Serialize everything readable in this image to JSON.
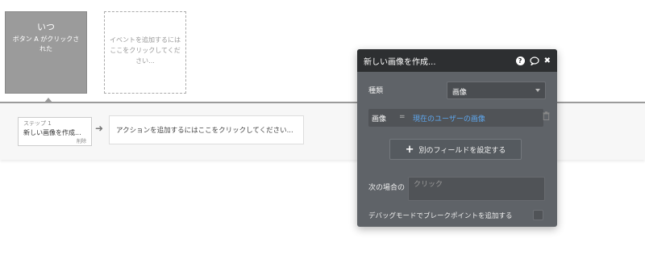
{
  "event": {
    "title": "いつ",
    "description": "ボタン A がクリックされた"
  },
  "add_event": {
    "label": "イベントを追加するにはここをクリックしてください..."
  },
  "step": {
    "label": "ステップ 1",
    "name": "新しい画像を作成...",
    "delete_label": "削除"
  },
  "add_action": {
    "label": "アクションを追加するにはここをクリックしてください..."
  },
  "editor": {
    "title": "新しい画像を作成...",
    "type_label": "種類",
    "type_value": "画像",
    "field_name": "画像",
    "field_eq": "=",
    "field_value": "現在のユーザーの画像",
    "add_field_label": "別のフィールドを設定する",
    "condition_label": "次の場合の",
    "condition_placeholder": "クリック",
    "debug_label": "デバッグモードでブレークポイントを追加する"
  },
  "colors": {
    "event_card": "#9b9b9b",
    "editor_bg": "#5f6368",
    "editor_header": "#2d2f31",
    "link_blue": "#5ea8f0"
  }
}
